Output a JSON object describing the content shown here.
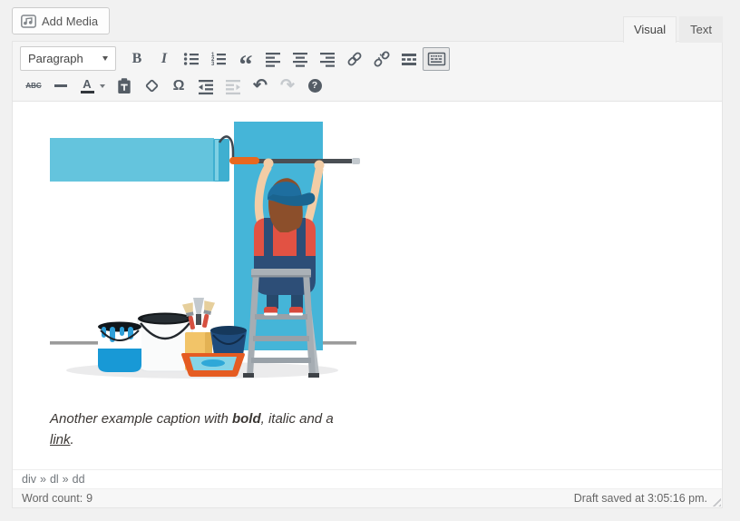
{
  "theme": {
    "colors": {
      "page_bg": "#f1f1f1",
      "toolbar_bg": "#f5f5f5",
      "border": "#e5e5e5",
      "icon": "#555d66",
      "icon_disabled": "#c5c9cd",
      "button_text": "#555555",
      "tab_inactive_bg": "#ebebeb",
      "caption_text": "#3b3734",
      "status_text": "#72777c",
      "footer_text": "#666666",
      "wall_blue": "#45b5d8",
      "stripe_blue": "#64c4dd",
      "roller_blue": "#3fafd0",
      "pole_gray": "#4a4f54",
      "grip_orange": "#e8681f",
      "shirt_red": "#e25243",
      "overalls_blue": "#2d4e77",
      "pants_blue": "#27496c",
      "cap_blue": "#1e6e9f",
      "skin": "#f2cda6",
      "hair": "#8c4f2b",
      "ladder_gray": "#a6adb3",
      "tray_orange": "#e55c22",
      "bucket_navy": "#1f4c7d",
      "can_blue": "#1899d6",
      "line_gray": "#9b9b9b",
      "shadow_gray": "#ebebec"
    }
  },
  "media_bar": {
    "add_media": "Add Media"
  },
  "tabs": {
    "visual": "Visual",
    "text": "Text",
    "active_tab": "Visual"
  },
  "toolbar": {
    "block_select": {
      "value": "Paragraph"
    },
    "glyphs": {
      "bold": "B",
      "italic": "I",
      "blockquote": "“",
      "strikethrough": "ABC",
      "hr": "—",
      "textcolor": "A",
      "charmap": "Ω",
      "undo": "↶",
      "redo": "↷",
      "help": "?"
    },
    "row1_buttons": [
      "paragraph-select",
      "bold",
      "italic",
      "bulleted-list",
      "numbered-list",
      "blockquote",
      "align-left",
      "align-center",
      "align-right",
      "insert-link",
      "remove-link",
      "read-more-tag",
      "toolbar-toggle"
    ],
    "row2_buttons": [
      "strikethrough",
      "horizontal-rule",
      "text-color",
      "paste-as-text",
      "clear-formatting",
      "special-character",
      "decrease-indent",
      "increase-indent",
      "undo",
      "redo",
      "keyboard-shortcuts-help"
    ],
    "toolbar_toggle_active": true,
    "disabled_buttons": [
      "increase-indent",
      "redo"
    ]
  },
  "content": {
    "illustration_alt": "Painter on a stepladder painting a wall blue with a roller; paint cans, brushes, bucket and roller tray on the floor",
    "caption": {
      "text_before_bold": "Another example caption with ",
      "bold": "bold",
      "between": ", italic and a ",
      "link": "link",
      "after": "."
    }
  },
  "statusbar": {
    "path": [
      "div",
      "dl",
      "dd"
    ],
    "path_separator": "»",
    "word_count_label": "Word count:",
    "word_count_value": "9",
    "draft_saved": "Draft saved at 3:05:16 pm."
  }
}
